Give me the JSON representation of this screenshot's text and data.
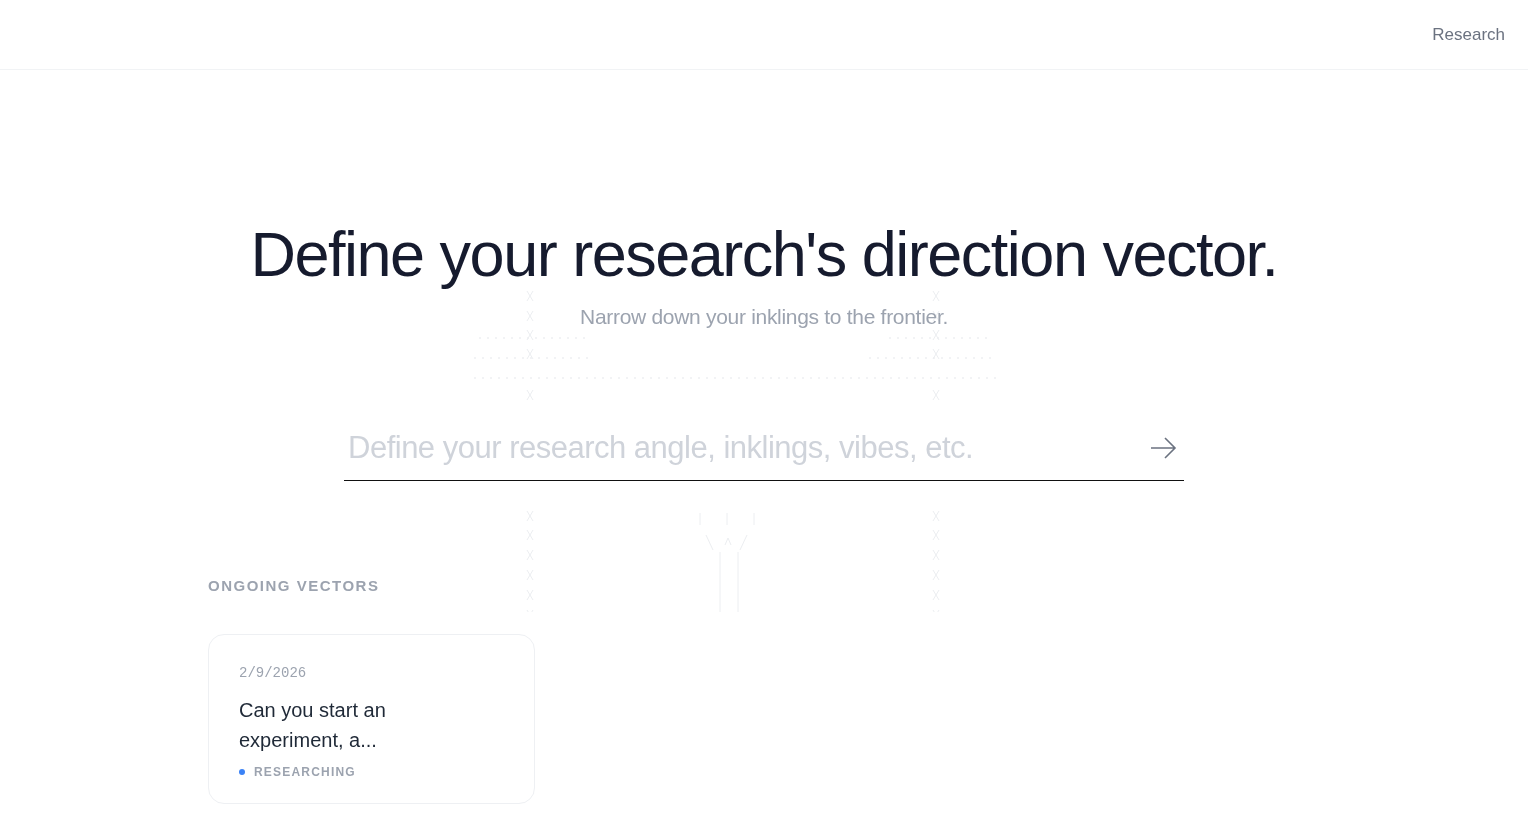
{
  "nav": {
    "link": "Research"
  },
  "hero": {
    "title": "Define your research's direction vector.",
    "subtitle": "Narrow down your inklings to the frontier."
  },
  "prompt": {
    "placeholder": "Define your research angle, inklings, vibes, etc."
  },
  "ongoing": {
    "heading": "ONGOING VECTORS",
    "cards": [
      {
        "date": "2/9/2026",
        "title": "Can you start an experiment, a...",
        "status": "RESEARCHING",
        "color": "#3b82f6"
      }
    ]
  }
}
